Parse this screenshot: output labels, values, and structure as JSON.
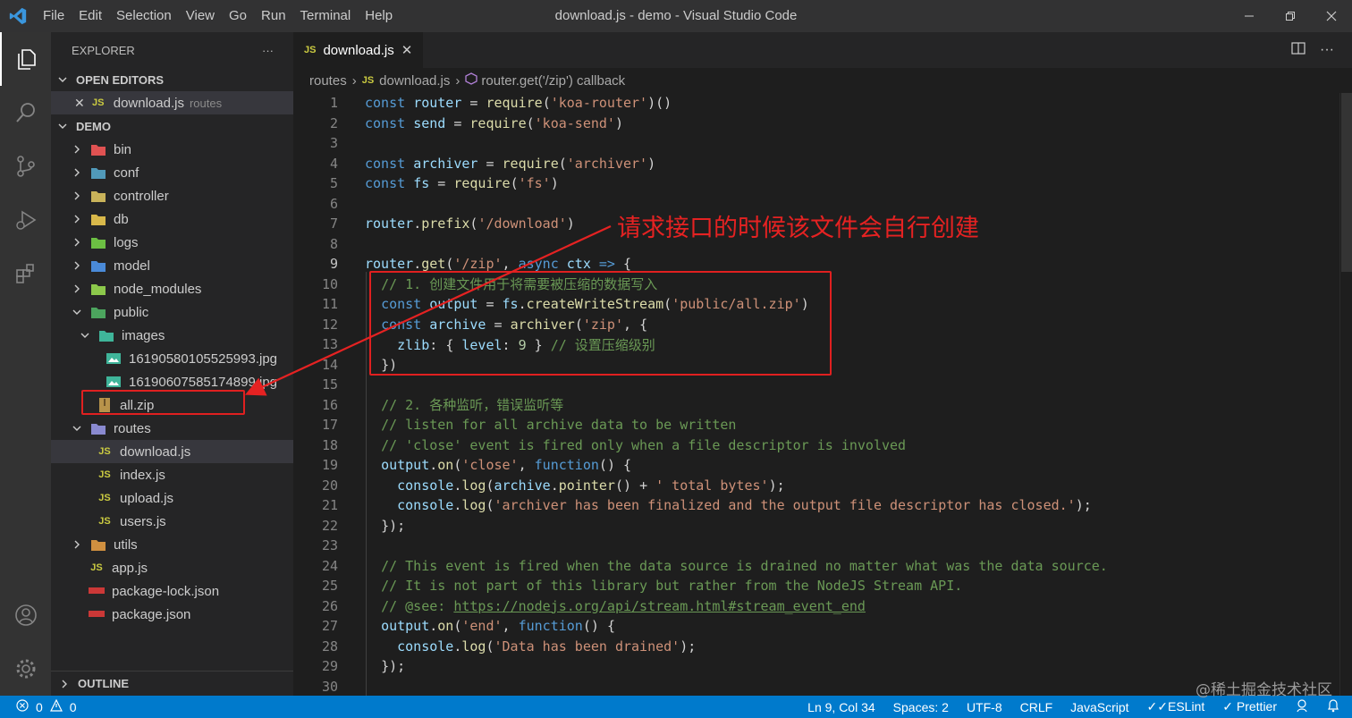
{
  "window": {
    "title": "download.js - demo - Visual Studio Code",
    "menu": [
      "File",
      "Edit",
      "Selection",
      "View",
      "Go",
      "Run",
      "Terminal",
      "Help"
    ]
  },
  "sidebar": {
    "header": "EXPLORER",
    "open_editors_title": "OPEN EDITORS",
    "open_editor": {
      "name": "download.js",
      "folder": "routes"
    },
    "project_title": "DEMO",
    "tree": [
      {
        "name": "bin"
      },
      {
        "name": "conf"
      },
      {
        "name": "controller"
      },
      {
        "name": "db"
      },
      {
        "name": "logs"
      },
      {
        "name": "model"
      },
      {
        "name": "node_modules"
      },
      {
        "name": "public"
      },
      {
        "name": "images"
      },
      {
        "name": "16190580105525993.jpg"
      },
      {
        "name": "16190607585174899.jpg"
      },
      {
        "name": "all.zip"
      },
      {
        "name": "routes"
      },
      {
        "name": "download.js"
      },
      {
        "name": "index.js"
      },
      {
        "name": "upload.js"
      },
      {
        "name": "users.js"
      },
      {
        "name": "utils"
      },
      {
        "name": "app.js"
      },
      {
        "name": "package-lock.json"
      },
      {
        "name": "package.json"
      }
    ],
    "outline_title": "OUTLINE"
  },
  "editor": {
    "tab_label": "download.js",
    "breadcrumb": [
      "routes",
      "download.js",
      "router.get('/zip') callback"
    ],
    "current_line": 9
  },
  "code_lines": [
    "const router = require('koa-router')()",
    "const send = require('koa-send')",
    "",
    "const archiver = require('archiver')",
    "const fs = require('fs')",
    "",
    "router.prefix('/download')",
    "",
    "router.get('/zip', async ctx => {",
    "  // 1. 创建文件用于将需要被压缩的数据写入",
    "  const output = fs.createWriteStream('public/all.zip')",
    "  const archive = archiver('zip', {",
    "    zlib: { level: 9 } // 设置压缩级别",
    "  })",
    "",
    "  // 2. 各种监听，错误监听等",
    "  // listen for all archive data to be written",
    "  // 'close' event is fired only when a file descriptor is involved",
    "  output.on('close', function() {",
    "    console.log(archive.pointer() + ' total bytes');",
    "    console.log('archiver has been finalized and the output file descriptor has closed.');",
    "  });",
    "",
    "  // This event is fired when the data source is drained no matter what was the data source.",
    "  // It is not part of this library but rather from the NodeJS Stream API.",
    "  // @see: https://nodejs.org/api/stream.html#stream_event_end",
    "  output.on('end', function() {",
    "    console.log('Data has been drained');",
    "  });",
    ""
  ],
  "annotation": {
    "text": "请求接口的时候该文件会自行创建",
    "color": "#e52222"
  },
  "statusbar": {
    "errors": "0",
    "warnings": "0",
    "position": "Ln 9, Col 34",
    "spaces": "Spaces: 2",
    "encoding": "UTF-8",
    "eol": "CRLF",
    "language": "JavaScript",
    "eslint": "ESLint",
    "prettier": "Prettier"
  },
  "watermark": "@稀土掘金技术社区"
}
